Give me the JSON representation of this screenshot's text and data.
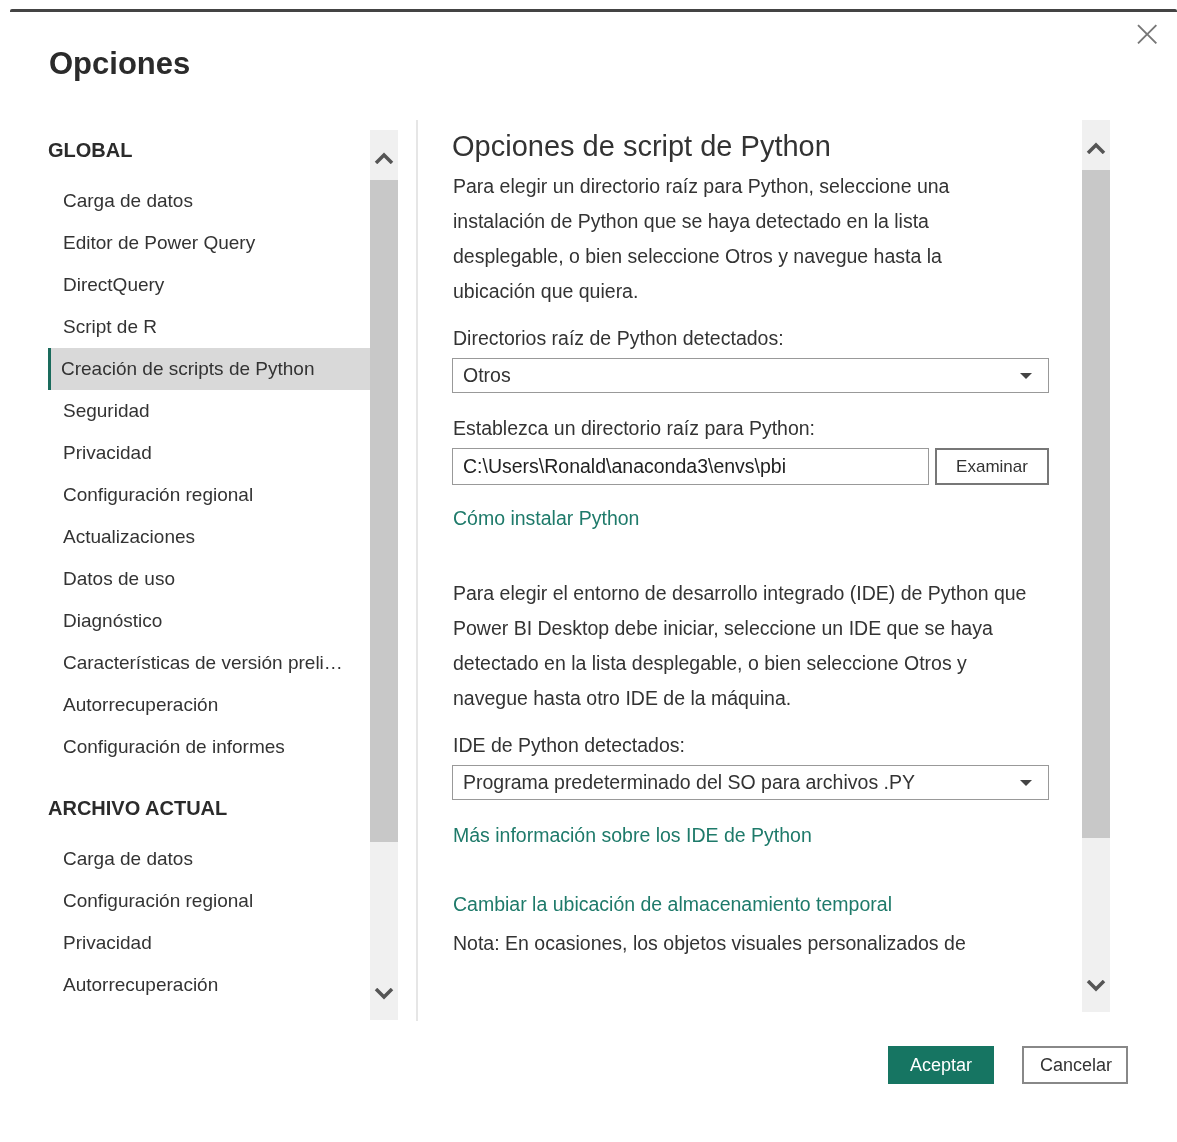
{
  "window": {
    "title": "Opciones",
    "close": "×"
  },
  "sidebar": {
    "sections": [
      {
        "header": "GLOBAL",
        "items": [
          {
            "label": "Carga de datos",
            "selected": false
          },
          {
            "label": "Editor de Power Query",
            "selected": false
          },
          {
            "label": "DirectQuery",
            "selected": false
          },
          {
            "label": "Script de R",
            "selected": false
          },
          {
            "label": "Creación de scripts de Python",
            "selected": true
          },
          {
            "label": "Seguridad",
            "selected": false
          },
          {
            "label": "Privacidad",
            "selected": false
          },
          {
            "label": "Configuración regional",
            "selected": false
          },
          {
            "label": "Actualizaciones",
            "selected": false
          },
          {
            "label": "Datos de uso",
            "selected": false
          },
          {
            "label": "Diagnóstico",
            "selected": false
          },
          {
            "label": "Características de versión preli…",
            "selected": false
          },
          {
            "label": "Autorrecuperación",
            "selected": false
          },
          {
            "label": "Configuración de informes",
            "selected": false
          }
        ]
      },
      {
        "header": "ARCHIVO ACTUAL",
        "items": [
          {
            "label": "Carga de datos",
            "selected": false
          },
          {
            "label": "Configuración regional",
            "selected": false
          },
          {
            "label": "Privacidad",
            "selected": false
          },
          {
            "label": "Autorrecuperación",
            "selected": false
          }
        ]
      }
    ]
  },
  "content": {
    "heading": "Opciones de script de Python",
    "blocks": [
      {
        "kind": "paragraph",
        "text": "Para elegir un directorio raíz para Python, seleccione una instalación de Python que se haya detectado en la lista desplegable, o bien seleccione Otros y navegue hasta la ubicación que quiera."
      },
      {
        "kind": "label",
        "text": "Directorios raíz de Python detectados:"
      },
      {
        "kind": "dropdown",
        "value": "Otros"
      },
      {
        "kind": "label",
        "text": "Establezca un directorio raíz para Python:"
      },
      {
        "kind": "path",
        "value": "C:\\Users\\Ronald\\anaconda3\\envs\\pbi",
        "button": "Examinar"
      },
      {
        "kind": "link",
        "text": "Cómo instalar Python"
      },
      {
        "kind": "paragraph",
        "text": "Para elegir el entorno de desarrollo integrado (IDE) de Python que Power BI Desktop debe iniciar, seleccione un IDE que se haya detectado en la lista desplegable, o bien seleccione Otros y navegue hasta otro IDE de la máquina."
      },
      {
        "kind": "label",
        "text": "IDE de Python detectados:"
      },
      {
        "kind": "dropdown",
        "value": "Programa predeterminado del SO para archivos .PY"
      },
      {
        "kind": "link",
        "text": "Más información sobre los IDE de Python"
      },
      {
        "kind": "link",
        "text": "Cambiar la ubicación de almacenamiento temporal"
      },
      {
        "kind": "paragraph",
        "text": "Nota: En ocasiones, los objetos visuales personalizados de"
      }
    ]
  },
  "buttons": [
    {
      "label": "Aceptar",
      "primary": true
    },
    {
      "label": "Cancelar",
      "primary": false
    }
  ]
}
